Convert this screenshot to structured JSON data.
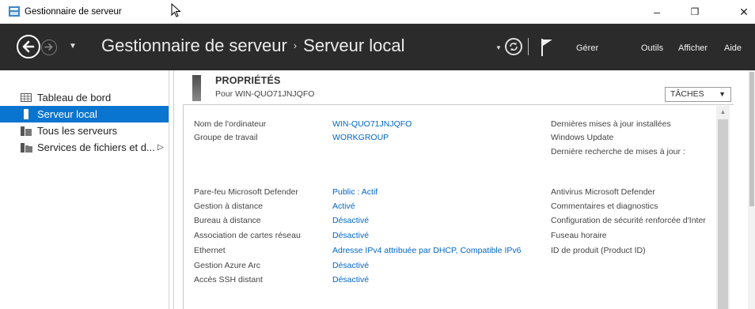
{
  "window": {
    "title": "Gestionnaire de serveur",
    "controls": [
      "–",
      "❐",
      "✕"
    ]
  },
  "header": {
    "title": "Gestionnaire de serveur",
    "separator": "›",
    "subtitle": "Serveur local",
    "menu": [
      "Gérer",
      "Outils",
      "Afficher",
      "Aide"
    ]
  },
  "sidebar": {
    "items": [
      {
        "label": "Tableau de bord",
        "icon": "dashboard-icon",
        "active": false
      },
      {
        "label": "Serveur local",
        "icon": "server-icon",
        "active": true
      },
      {
        "label": "Tous les serveurs",
        "icon": "servers-icon",
        "active": false
      },
      {
        "label": "Services de fichiers et d...",
        "icon": "file-services-icon",
        "active": false,
        "expand": "▷"
      }
    ]
  },
  "properties": {
    "title": "PROPRIÉTÉS",
    "subtitle": "Pour WIN-QUO71JNJQFO",
    "tasks_label": "TÂCHES",
    "left_rows": [
      {
        "label": "Nom de l'ordinateur",
        "value": "WIN-QUO71JNJQFO"
      },
      {
        "label": "Groupe de travail",
        "value": "WORKGROUP"
      },
      {
        "label": "Pare-feu Microsoft Defender",
        "value": "Public : Actif"
      },
      {
        "label": "Gestion à distance",
        "value": "Activé"
      },
      {
        "label": "Bureau à distance",
        "value": "Désactivé"
      },
      {
        "label": "Association de cartes réseau",
        "value": "Désactivé"
      },
      {
        "label": "Ethernet",
        "value": "Adresse IPv4 attribuée par DHCP, Compatible IPv6"
      },
      {
        "label": "Gestion Azure Arc",
        "value": "Désactivé"
      },
      {
        "label": "Accès SSH distant",
        "value": "Désactivé"
      }
    ],
    "right_rows": [
      "Dernières mises à jour installées",
      "Windows Update",
      "Dernière recherche de mises à jour :",
      "Antivirus Microsoft Defender",
      "Commentaires et diagnostics",
      "Configuration de sécurité renforcée d'Inter",
      "Fuseau horaire",
      "ID de produit (Product ID)"
    ]
  }
}
